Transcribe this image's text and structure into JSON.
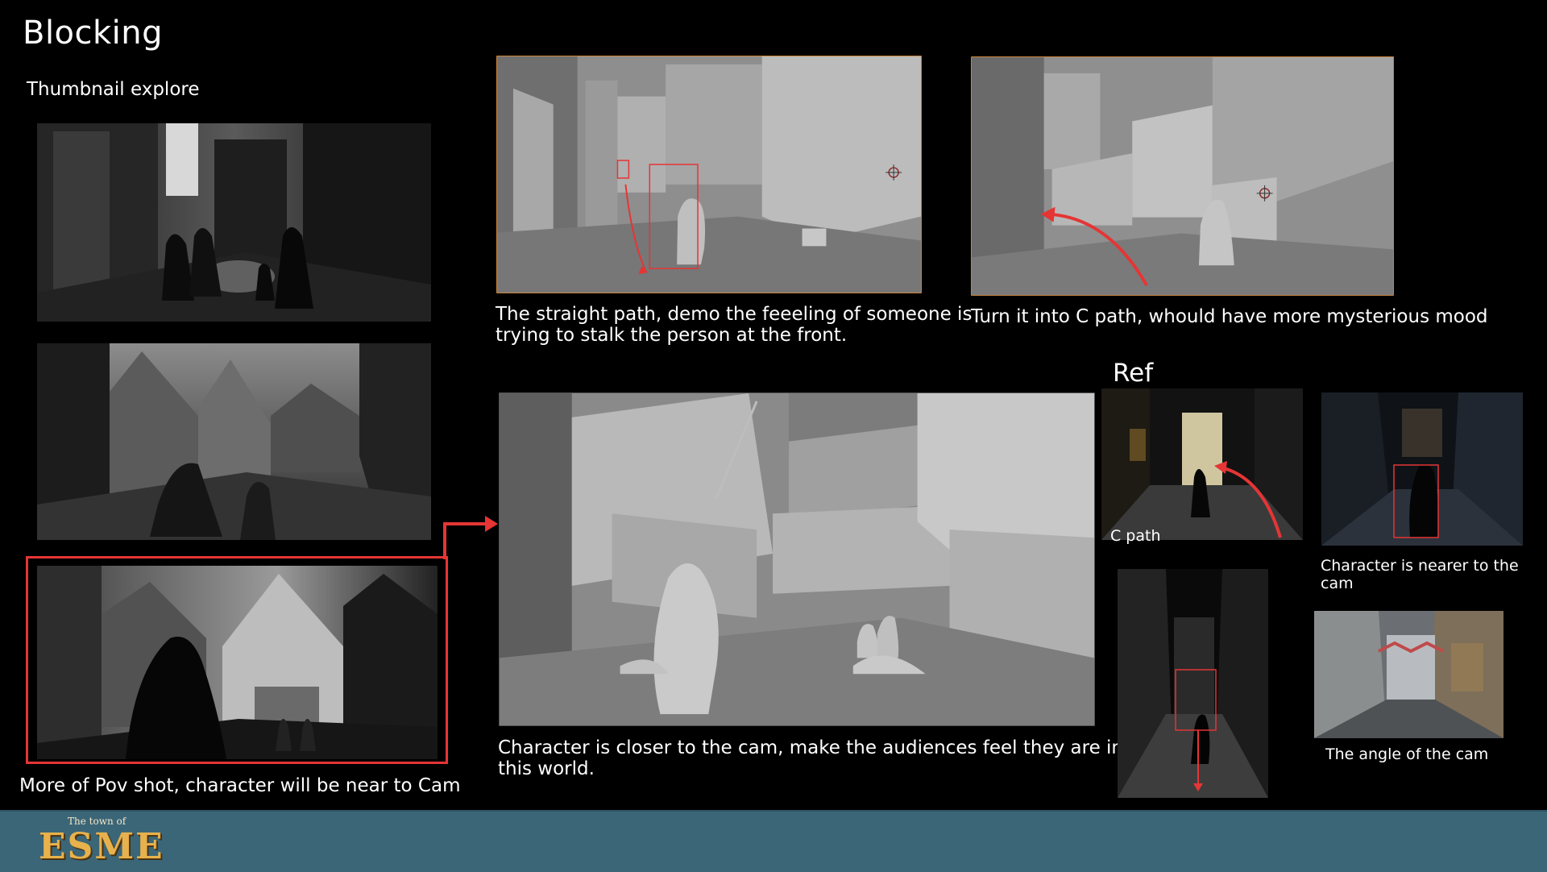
{
  "page": {
    "title": "Blocking",
    "subtitle": "Thumbnail explore",
    "ref_title": "Ref"
  },
  "captions": {
    "thumb3": "More of Pov shot, character will be near to Cam",
    "render_straight": "The straight path, demo the feeeling of someone is\ntrying to stalk the person at the front.",
    "render_cpath": "Turn it into C path, whould have more mysterious mood",
    "render_close": "Character is closer to the cam, make the audiences feel they are in\n this world.",
    "ref_cpath": "C path",
    "ref_nearer": "Character is nearer to the cam",
    "ref_angle": "The angle of the cam"
  },
  "footer": {
    "logo_small": "The town of",
    "logo_big": "ESME"
  },
  "colors": {
    "background": "#000000",
    "footer": "#3b6678",
    "annotation_red": "#e53535",
    "render_border": "#c8833a",
    "logo_gold": "#e7b24d"
  }
}
